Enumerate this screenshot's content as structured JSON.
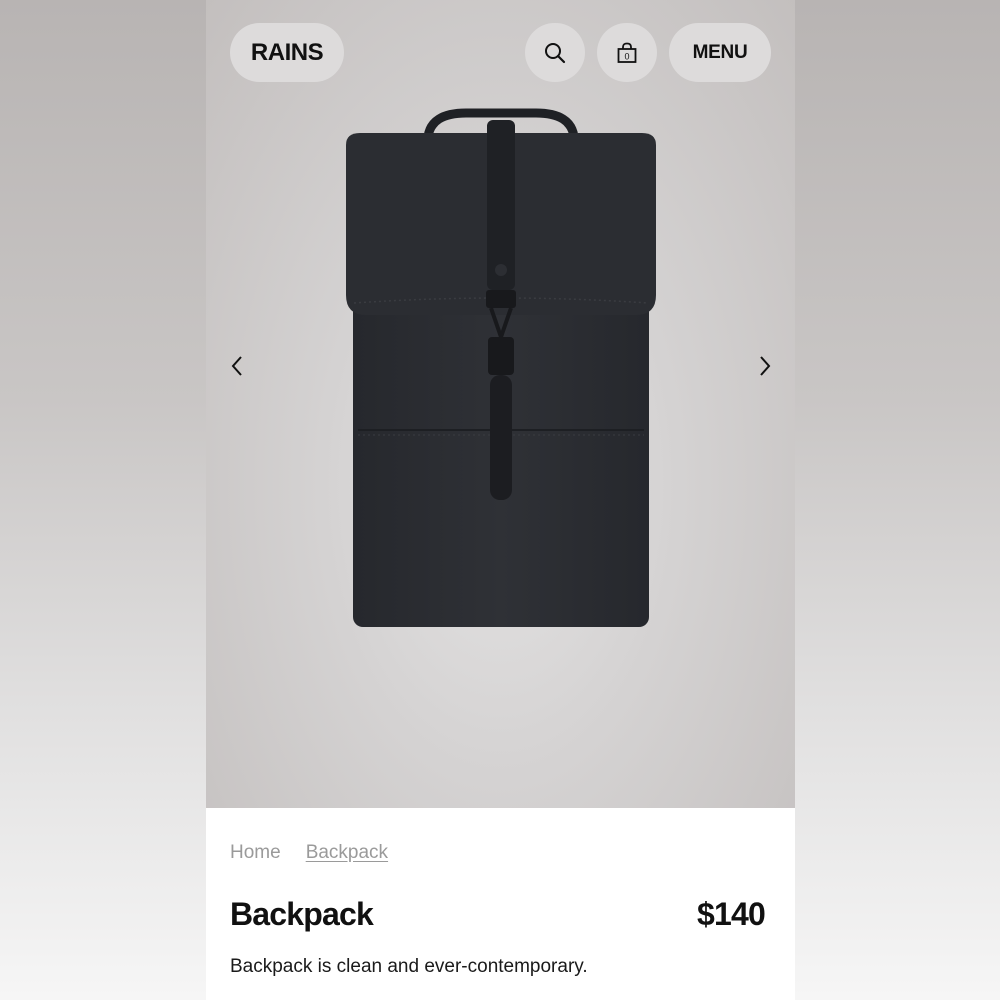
{
  "header": {
    "logo": "RAINS",
    "search_icon": "search-icon",
    "bag_icon": "shopping-bag-icon",
    "bag_count": "0",
    "menu_label": "MENU"
  },
  "carousel": {
    "prev_icon": "chevron-left-icon",
    "next_icon": "chevron-right-icon",
    "image": "black-backpack-product-photo"
  },
  "breadcrumb": {
    "items": [
      "Home",
      "Backpack"
    ]
  },
  "product": {
    "name": "Backpack",
    "price": "$140",
    "description": "Backpack is clean and ever-contemporary."
  },
  "colors": {
    "pill_bg": "#dddbdb",
    "text": "#111111",
    "muted": "#9a9a9a"
  }
}
